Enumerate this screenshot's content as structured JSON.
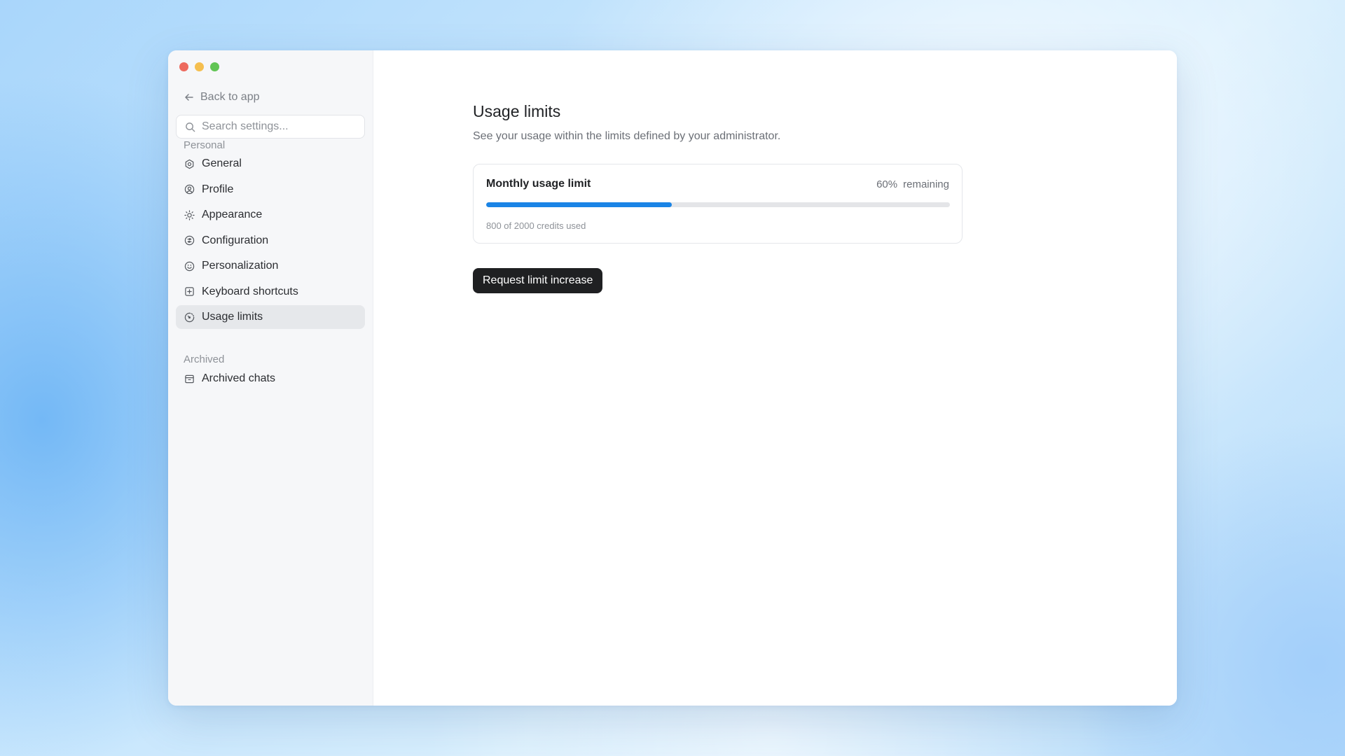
{
  "sidebar": {
    "back_label": "Back to app",
    "search_placeholder": "Search settings...",
    "sections": [
      {
        "label": "Personal",
        "items": [
          {
            "label": "General",
            "icon": "gear-icon"
          },
          {
            "label": "Profile",
            "icon": "user-circle-icon"
          },
          {
            "label": "Appearance",
            "icon": "sun-icon"
          },
          {
            "label": "Configuration",
            "icon": "sliders-icon"
          },
          {
            "label": "Personalization",
            "icon": "smile-icon"
          },
          {
            "label": "Keyboard shortcuts",
            "icon": "keyboard-icon"
          },
          {
            "label": "Usage limits",
            "icon": "gauge-icon",
            "active": true
          }
        ]
      },
      {
        "label": "Archived",
        "items": [
          {
            "label": "Archived chats",
            "icon": "archive-icon"
          }
        ]
      }
    ]
  },
  "main": {
    "title": "Usage limits",
    "subtitle": "See your usage within the limits defined by your administrator.",
    "card": {
      "title": "Monthly usage limit",
      "remaining_percent": "60%",
      "remaining_label": "remaining",
      "used_fraction": 0.4,
      "credits_text": "800 of 2000 credits used"
    },
    "request_button_label": "Request limit increase"
  },
  "colors": {
    "accent": "#1a84e6",
    "button_bg": "#1f2022",
    "active_item_bg": "#e6e8eb"
  }
}
